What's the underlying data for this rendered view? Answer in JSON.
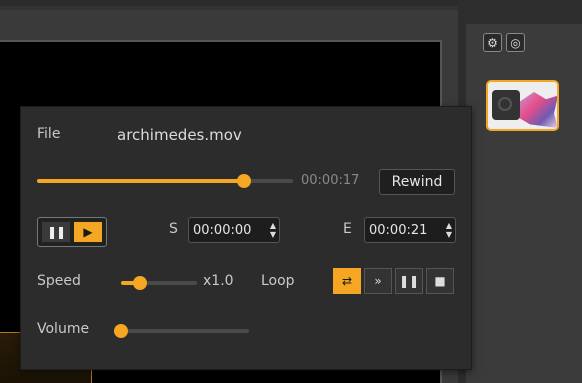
{
  "file": {
    "label": "File",
    "name": "archimedes.mov"
  },
  "playback": {
    "current_time": "00:00:17",
    "progress": 0.81,
    "rewind_label": "Rewind",
    "pause_icon": "pause-icon",
    "play_icon": "play-icon"
  },
  "range": {
    "start_label": "S",
    "start_value": "00:00:00",
    "end_label": "E",
    "end_value": "00:00:21"
  },
  "speed": {
    "label": "Speed",
    "value": "x1.0",
    "level": 0.25
  },
  "loop": {
    "label": "Loop",
    "modes": [
      {
        "icon": "loop-repeat-icon",
        "active": true
      },
      {
        "icon": "loop-next-icon",
        "active": false
      },
      {
        "icon": "loop-pause-icon",
        "active": false
      },
      {
        "icon": "loop-stop-icon",
        "active": false
      }
    ]
  },
  "volume": {
    "label": "Volume",
    "level": 0.0
  },
  "toolbar": {
    "gear_icon": "gear-icon",
    "target_icon": "target-icon"
  },
  "colors": {
    "accent": "#f5a623",
    "panel": "#2c2c2c",
    "background": "#3a3a3a"
  }
}
